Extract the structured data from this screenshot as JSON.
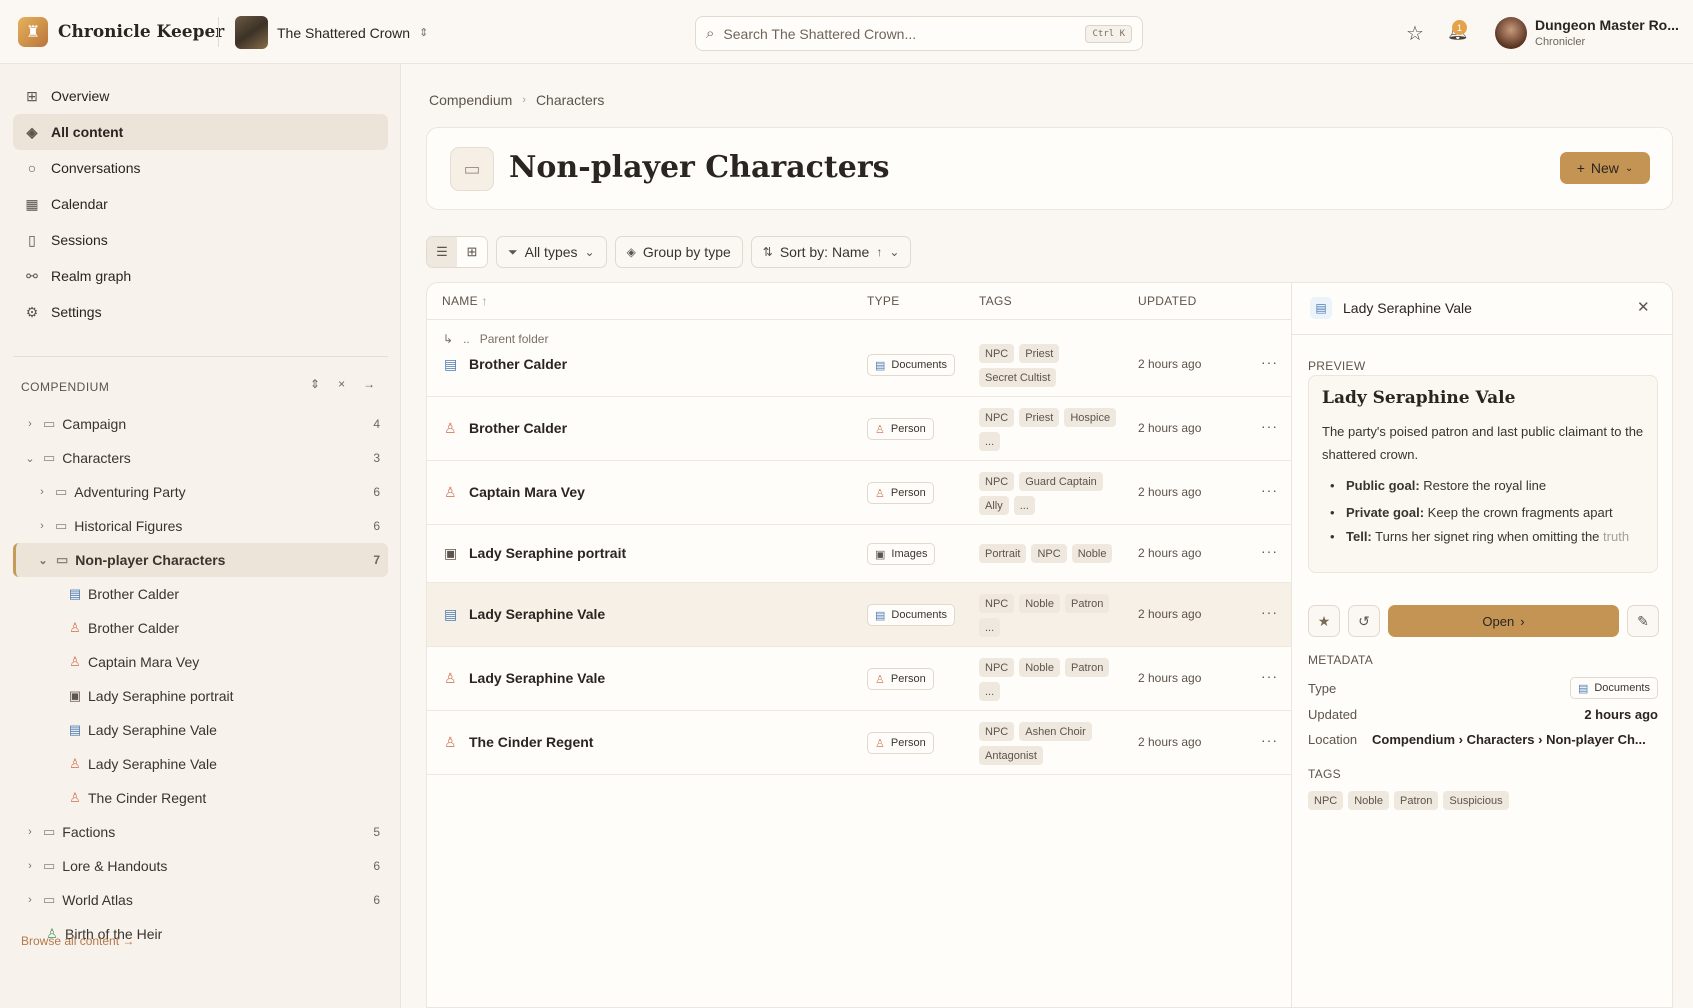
{
  "app": {
    "name": "Chronicle Keeper",
    "campaign": "The Shattered Crown"
  },
  "search": {
    "placeholder": "Search The Shattered Crown...",
    "shortcut": "Ctrl K"
  },
  "notifications": {
    "count": "1"
  },
  "user": {
    "name": "Dungeon Master Ro...",
    "role": "Chronicler"
  },
  "nav": [
    {
      "label": "Overview",
      "icon": "overview-grid-icon"
    },
    {
      "label": "All content",
      "icon": "layers-icon",
      "active": true
    },
    {
      "label": "Conversations",
      "icon": "chat-bubble-icon"
    },
    {
      "label": "Calendar",
      "icon": "calendar-icon"
    },
    {
      "label": "Sessions",
      "icon": "book-icon"
    },
    {
      "label": "Realm graph",
      "icon": "graph-nodes-icon"
    },
    {
      "label": "Settings",
      "icon": "gear-icon"
    }
  ],
  "compendium": {
    "heading": "COMPENDIUM",
    "tree": [
      {
        "label": "Campaign",
        "count": "4"
      },
      {
        "label": "Characters",
        "count": "3"
      },
      {
        "label": "Adventuring Party",
        "count": "6"
      },
      {
        "label": "Historical Figures",
        "count": "6"
      },
      {
        "label": "Non-player Characters",
        "count": "7"
      },
      {
        "label": "Brother Calder"
      },
      {
        "label": "Brother Calder"
      },
      {
        "label": "Captain Mara Vey"
      },
      {
        "label": "Lady Seraphine portrait"
      },
      {
        "label": "Lady Seraphine Vale"
      },
      {
        "label": "Lady Seraphine Vale"
      },
      {
        "label": "The Cinder Regent"
      },
      {
        "label": "Factions",
        "count": "5"
      },
      {
        "label": "Lore & Handouts",
        "count": "6"
      },
      {
        "label": "World Atlas",
        "count": "6"
      },
      {
        "label": "Birth of the Heir"
      }
    ],
    "browse_all": "Browse all content"
  },
  "breadcrumb": [
    "Compendium",
    "Characters"
  ],
  "page": {
    "title": "Non-player Characters",
    "new_label": "New"
  },
  "toolbar": {
    "types": "All types",
    "group": "Group by type",
    "sort": "Sort by: Name"
  },
  "table": {
    "headers": {
      "name": "NAME",
      "type": "TYPE",
      "tags": "TAGS",
      "updated": "UPDATED"
    },
    "parent": "Parent folder",
    "rows": [
      {
        "name": "Brother Calder",
        "type": "Documents",
        "kind": "doc",
        "tags": [
          "NPC",
          "Priest",
          "Secret Cultist"
        ],
        "updated": "2 hours ago"
      },
      {
        "name": "Brother Calder",
        "type": "Person",
        "kind": "person",
        "tags": [
          "NPC",
          "Priest",
          "Hospice",
          "..."
        ],
        "updated": "2 hours ago"
      },
      {
        "name": "Captain Mara Vey",
        "type": "Person",
        "kind": "person",
        "tags": [
          "NPC",
          "Guard Captain",
          "Ally",
          "..."
        ],
        "updated": "2 hours ago"
      },
      {
        "name": "Lady Seraphine portrait",
        "type": "Images",
        "kind": "img",
        "tags": [
          "Portrait",
          "NPC",
          "Noble"
        ],
        "updated": "2 hours ago"
      },
      {
        "name": "Lady Seraphine Vale",
        "type": "Documents",
        "kind": "doc",
        "tags": [
          "NPC",
          "Noble",
          "Patron",
          "..."
        ],
        "updated": "2 hours ago",
        "selected": true
      },
      {
        "name": "Lady Seraphine Vale",
        "type": "Person",
        "kind": "person",
        "tags": [
          "NPC",
          "Noble",
          "Patron",
          "..."
        ],
        "updated": "2 hours ago"
      },
      {
        "name": "The Cinder Regent",
        "type": "Person",
        "kind": "person",
        "tags": [
          "NPC",
          "Ashen Choir",
          "Antagonist"
        ],
        "updated": "2 hours ago"
      }
    ]
  },
  "panel": {
    "title": "Lady Seraphine Vale",
    "preview_label": "PREVIEW",
    "preview_title": "Lady Seraphine Vale",
    "preview_desc": "The party's poised patron and last public claimant to the shattered crown.",
    "goals": [
      {
        "key": "Public goal:",
        "text": "Restore the royal line"
      },
      {
        "key": "Private goal:",
        "text": "Keep the crown fragments apart"
      },
      {
        "key": "Tell:",
        "text": "Turns her signet ring when omitting the",
        "rest": "truth"
      }
    ],
    "open_label": "Open",
    "metadata_label": "METADATA",
    "meta": {
      "type_label": "Type",
      "type_value": "Documents",
      "updated_label": "Updated",
      "updated_value": "2 hours ago",
      "location_label": "Location",
      "location_value": "Compendium › Characters › Non-player Ch..."
    },
    "tags_label": "TAGS",
    "tags": [
      "NPC",
      "Noble",
      "Patron",
      "Suspicious"
    ]
  },
  "colors": {
    "accent": "#c39454",
    "doc": "#4b7bb5",
    "person": "#d47e62"
  }
}
